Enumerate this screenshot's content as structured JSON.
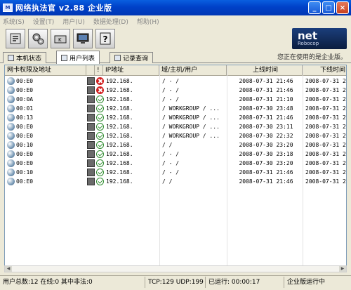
{
  "window": {
    "title": "网络执法官 v2.88 企业版",
    "buttons": [
      "_",
      "□",
      "×"
    ]
  },
  "menu": [
    "系统(S)",
    "设置(T)",
    "用户(U)",
    "数据处理(D)",
    "帮助(H)"
  ],
  "toolbar": {
    "icons": [
      "settings-icon",
      "gears-icon",
      "keyboard-icon",
      "monitor-icon",
      "help-icon"
    ]
  },
  "logo": {
    "line1": "net",
    "line2": "Robocop"
  },
  "tabs": [
    {
      "label": "本机状态"
    },
    {
      "label": "用户列表",
      "active": true
    },
    {
      "label": "记录查询"
    }
  ],
  "edition_note": "您正在使用的是企业版。",
  "table": {
    "columns": [
      "网卡权限及地址",
      "",
      "!",
      "IP地址",
      "域/主机/用户",
      "上线时间",
      "下线时间"
    ],
    "rows": [
      {
        "mac": "00:E0",
        "status": "bad",
        "ip": "192.168.",
        "host": "/ - /",
        "on": "2008-07-31 21:46",
        "off": "2008-07-31 21:4"
      },
      {
        "mac": "00:E0",
        "status": "bad",
        "ip": "192.168.",
        "host": "/ - /",
        "on": "2008-07-31 21:46",
        "off": "2008-07-31 21:4"
      },
      {
        "mac": "00:0A",
        "status": "ok",
        "ip": "192.168.",
        "host": "/ - /",
        "on": "2008-07-31 21:10",
        "off": "2008-07-31 21:4"
      },
      {
        "mac": "00:01",
        "status": "ok",
        "ip": "192.168.",
        "host": "/ WORKGROUP / ...",
        "on": "2008-07-30 23:48",
        "off": "2008-07-31 21:4"
      },
      {
        "mac": "00:13",
        "status": "ok",
        "ip": "192.168.",
        "host": "/ WORKGROUP / ...",
        "on": "2008-07-31 21:46",
        "off": "2008-07-31 21:4"
      },
      {
        "mac": "00:E0",
        "status": "ok",
        "ip": "192.168.",
        "host": "/ WORKGROUP / ...",
        "on": "2008-07-30 23:11",
        "off": "2008-07-31 21:4"
      },
      {
        "mac": "00:E0",
        "status": "ok",
        "ip": "192.168.",
        "host": "/ WORKGROUP / ...",
        "on": "2008-07-30 22:32",
        "off": "2008-07-31 21:4"
      },
      {
        "mac": "00:10",
        "status": "ok",
        "ip": "192.168.",
        "host": "/ /",
        "on": "2008-07-30 23:20",
        "off": "2008-07-31 21:4"
      },
      {
        "mac": "00:E0",
        "status": "ok",
        "ip": "192.168.",
        "host": "/ - /",
        "on": "2008-07-30 23:18",
        "off": "2008-07-31 21:4"
      },
      {
        "mac": "00:E0",
        "status": "ok",
        "ip": "192.168.",
        "host": "/ - /",
        "on": "2008-07-30 23:20",
        "off": "2008-07-31 21:4"
      },
      {
        "mac": "00:10",
        "status": "ok",
        "ip": "192.168.",
        "host": "/ - /",
        "on": "2008-07-31 21:46",
        "off": "2008-07-31 21:4"
      },
      {
        "mac": "00:E0",
        "status": "ok",
        "ip": "192.168.",
        "host": "/ /",
        "on": "2008-07-31 21:46",
        "off": "2008-07-31 21:4"
      }
    ]
  },
  "statusbar": {
    "summary": "用户总数:12 在线:0 其中非法:0",
    "packets": "TCP:129 UDP:199",
    "runtime": "已运行: 00:00:17",
    "mode": "企业版运行中"
  }
}
